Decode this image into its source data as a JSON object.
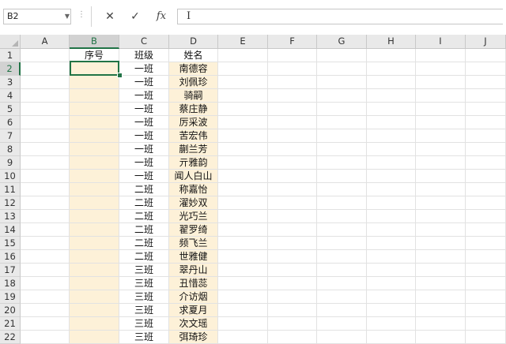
{
  "name_box": "B2",
  "formula_buttons": {
    "cancel": "✕",
    "enter": "✓",
    "function": "fx"
  },
  "formula_value": "",
  "columns": [
    "A",
    "B",
    "C",
    "D",
    "E",
    "F",
    "G",
    "H",
    "I",
    "J"
  ],
  "selected_column": "B",
  "selected_row": "2",
  "rows": [
    {
      "n": "1",
      "B": "序号",
      "C": "班级",
      "D": "姓名"
    },
    {
      "n": "2",
      "B": "",
      "C": "一班",
      "D": "南德容"
    },
    {
      "n": "3",
      "B": "",
      "C": "一班",
      "D": "刘佩珍"
    },
    {
      "n": "4",
      "B": "",
      "C": "一班",
      "D": "骑嗣"
    },
    {
      "n": "5",
      "B": "",
      "C": "一班",
      "D": "蔡庄静"
    },
    {
      "n": "6",
      "B": "",
      "C": "一班",
      "D": "厉采波"
    },
    {
      "n": "7",
      "B": "",
      "C": "一班",
      "D": "苦宏伟"
    },
    {
      "n": "8",
      "B": "",
      "C": "一班",
      "D": "蒯兰芳"
    },
    {
      "n": "9",
      "B": "",
      "C": "一班",
      "D": "亓雅韵"
    },
    {
      "n": "10",
      "B": "",
      "C": "一班",
      "D": "闻人白山"
    },
    {
      "n": "11",
      "B": "",
      "C": "二班",
      "D": "称嘉怡"
    },
    {
      "n": "12",
      "B": "",
      "C": "二班",
      "D": "濯妙双"
    },
    {
      "n": "13",
      "B": "",
      "C": "二班",
      "D": "光巧兰"
    },
    {
      "n": "14",
      "B": "",
      "C": "二班",
      "D": "翟罗绮"
    },
    {
      "n": "15",
      "B": "",
      "C": "二班",
      "D": "频飞兰"
    },
    {
      "n": "16",
      "B": "",
      "C": "二班",
      "D": "世雅健"
    },
    {
      "n": "17",
      "B": "",
      "C": "三班",
      "D": "翠丹山"
    },
    {
      "n": "18",
      "B": "",
      "C": "三班",
      "D": "丑惜蕊"
    },
    {
      "n": "19",
      "B": "",
      "C": "三班",
      "D": "介访烟"
    },
    {
      "n": "20",
      "B": "",
      "C": "三班",
      "D": "求夏月"
    },
    {
      "n": "21",
      "B": "",
      "C": "三班",
      "D": "次文瑶"
    },
    {
      "n": "22",
      "B": "",
      "C": "三班",
      "D": "弭琦珍"
    }
  ],
  "colors": {
    "accent": "#217346",
    "fill": "#fdf1d8"
  }
}
